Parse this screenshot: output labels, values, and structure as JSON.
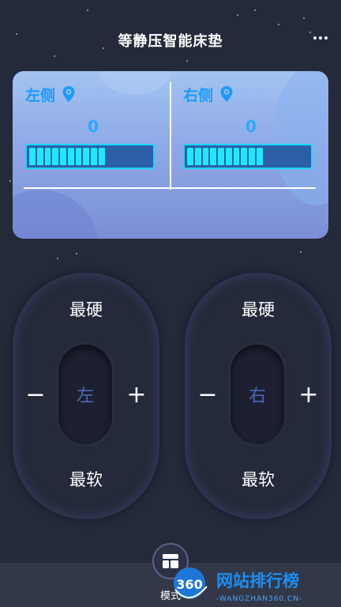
{
  "header": {
    "title": "等静压智能床垫"
  },
  "panel": {
    "left": {
      "label": "左侧",
      "value": "0",
      "level": 0.62
    },
    "right": {
      "label": "右侧",
      "value": "0",
      "level": 0.62
    }
  },
  "controls": {
    "left": {
      "hard_label": "最硬",
      "soft_label": "最软",
      "side_label": "左",
      "minus": "−",
      "plus": "+"
    },
    "right": {
      "hard_label": "最硬",
      "soft_label": "最软",
      "side_label": "右",
      "minus": "−",
      "plus": "+"
    }
  },
  "bottom": {
    "mode_label": "模式"
  },
  "watermark": {
    "badge": "360",
    "text": "网站排行榜",
    "sub": "-WANGZHAN360.CN-"
  },
  "colors": {
    "background": "#252a3b",
    "accent": "#1fe9ff",
    "label_blue": "#1a9bff",
    "knob_text": "#4f66b8"
  },
  "icons": {
    "more": "more-dots-icon",
    "pin": "location-pin-icon",
    "mode": "mode-layout-icon"
  }
}
